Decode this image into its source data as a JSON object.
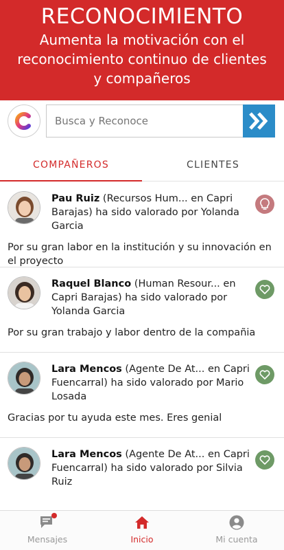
{
  "header": {
    "title": "RECONOCIMIENTO",
    "subtitle": "Aumenta la motivación con el reconocimiento continuo de clientes y compañeros"
  },
  "search": {
    "placeholder": "Busca y Reconoce"
  },
  "tabs": [
    {
      "label": "COMPAÑEROS",
      "active": true
    },
    {
      "label": "CLIENTES",
      "active": false
    }
  ],
  "feed": [
    {
      "name": "Pau Ruiz",
      "text": " (Recursos Hum... en Capri Barajas) ha sido valorado por Yolanda Garcia",
      "comment": "Por su gran labor en la institución y su innovación en el proyecto",
      "badge": "lightbulb-icon"
    },
    {
      "name": "Raquel Blanco",
      "text": " (Human Resour... en Capri Barajas) ha sido valorado por Yolanda Garcia",
      "comment": "Por su gran trabajo y labor dentro de la compañia",
      "badge": "heart-icon"
    },
    {
      "name": "Lara Mencos",
      "text": " (Agente De At... en Capri Fuencarral) ha sido valorado por Mario Losada",
      "comment": "Gracias por tu ayuda este mes. Eres genial",
      "badge": "heart-icon"
    },
    {
      "name": "Lara Mencos",
      "text": " (Agente De At... en Capri Fuencarral) ha sido valorado por Silvia Ruiz",
      "comment": "",
      "badge": "heart-icon"
    }
  ],
  "bottom_nav": [
    {
      "label": "Mensajes",
      "icon": "chat-icon",
      "active": false
    },
    {
      "label": "Inicio",
      "icon": "home-icon",
      "active": true
    },
    {
      "label": "Mi cuenta",
      "icon": "account-icon",
      "active": false
    }
  ],
  "colors": {
    "brand_red": "#d32a2a",
    "search_blue": "#2b8cc8",
    "badge_green": "#6e9a66",
    "badge_rose": "#c47a7e"
  }
}
